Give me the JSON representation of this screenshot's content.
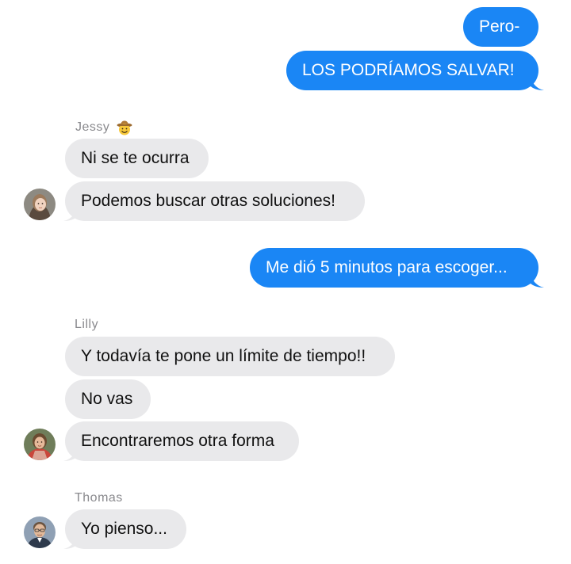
{
  "messages": [
    {
      "text": "Pero-"
    },
    {
      "text": "LOS PODRÍAMOS SALVAR!"
    },
    {
      "text": "Ni se te ocurra"
    },
    {
      "text": "Podemos buscar otras soluciones!"
    },
    {
      "text": "Me dió 5 minutos para escoger..."
    },
    {
      "text": "Y todavía te pone un límite de tiempo!!"
    },
    {
      "text": "No vas"
    },
    {
      "text": "Encontraremos otra forma"
    },
    {
      "text": "Yo pienso..."
    }
  ],
  "senders": {
    "jessy": "Jessy",
    "lilly": "Lilly",
    "thomas": "Thomas"
  },
  "icons": {
    "jessy_badge": "cowboy-face-icon"
  },
  "colors": {
    "outgoing_bubble": "#1a86f5",
    "incoming_bubble": "#e9e9eb",
    "sender_label": "#8a8a8e"
  }
}
